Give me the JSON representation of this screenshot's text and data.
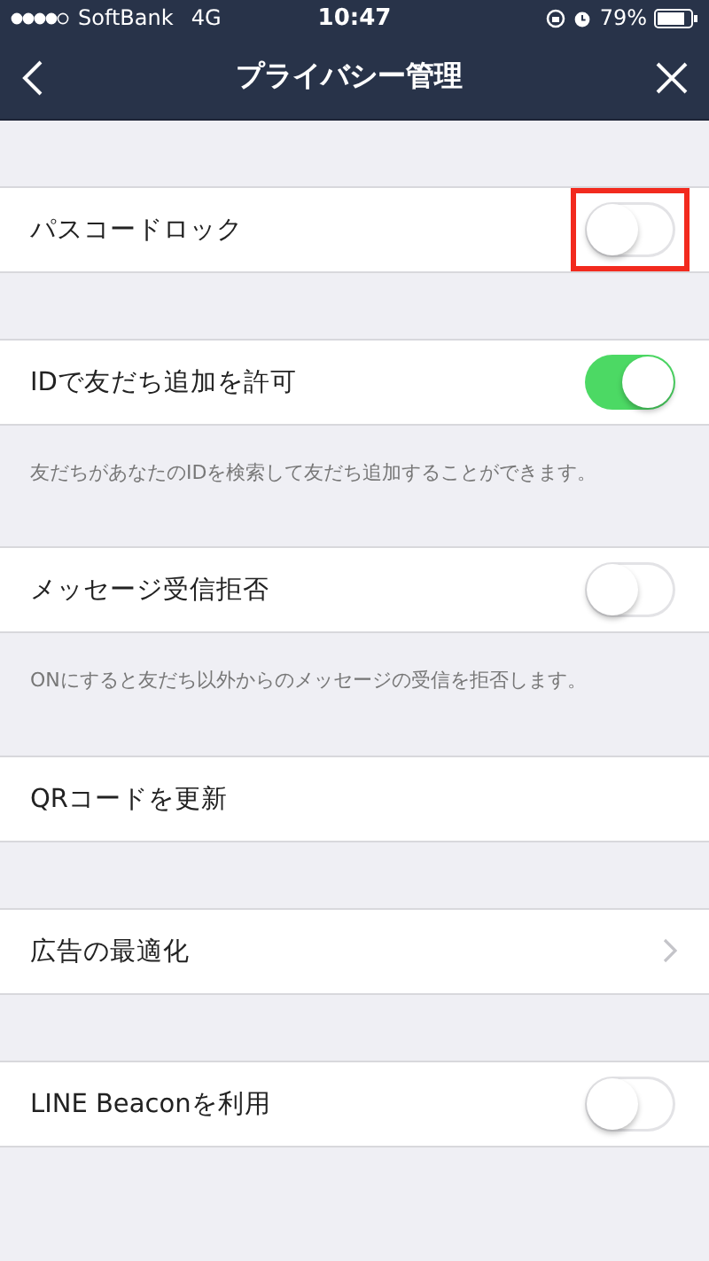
{
  "status_bar": {
    "carrier": "SoftBank",
    "network": "4G",
    "time": "10:47",
    "battery": "79%"
  },
  "nav": {
    "title": "プライバシー管理"
  },
  "sections": [
    {
      "kind": "toggle",
      "label": "パスコードロック",
      "on": false,
      "highlighted": true
    },
    {
      "kind": "toggle",
      "label": "IDで友だち追加を許可",
      "on": true,
      "highlighted": false,
      "note": "友だちがあなたのIDを検索して友だち追加することができます。"
    },
    {
      "kind": "toggle",
      "label": "メッセージ受信拒否",
      "on": false,
      "highlighted": false,
      "note": "ONにすると友だち以外からのメッセージの受信を拒否します。"
    },
    {
      "kind": "button",
      "label": "QRコードを更新"
    },
    {
      "kind": "link",
      "label": "広告の最適化"
    },
    {
      "kind": "toggle",
      "label": "LINE Beaconを利用",
      "on": false,
      "highlighted": false
    }
  ]
}
